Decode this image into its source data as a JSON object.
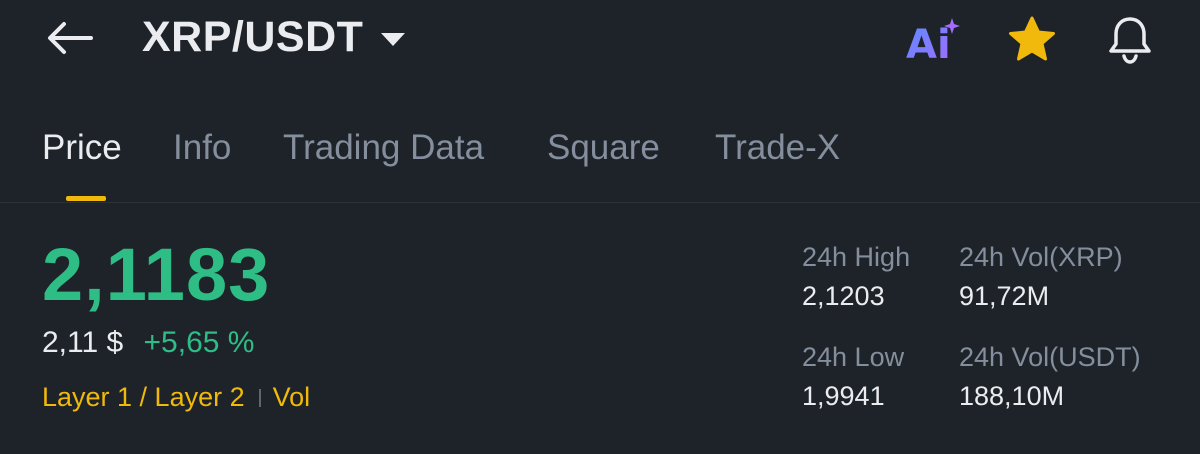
{
  "header": {
    "pair_title": "XRP/USDT",
    "ai_label": "Ai",
    "icons": [
      "back-arrow-icon",
      "chevron-down-icon",
      "ai-icon",
      "star-icon",
      "bell-icon"
    ],
    "star_color": "#f0b90b",
    "ai_gradient": [
      "#5b8cff",
      "#9b6bff"
    ]
  },
  "tabs": [
    {
      "label": "Price",
      "active": true
    },
    {
      "label": "Info",
      "active": false
    },
    {
      "label": "Trading Data",
      "active": false
    },
    {
      "label": "Square",
      "active": false
    },
    {
      "label": "Trade-X",
      "active": false
    }
  ],
  "ticker": {
    "last_price": "2,1183",
    "fiat_price": "2,11 $",
    "change_percent": "+5,65 %",
    "tag": "Layer 1 / Layer 2",
    "tag_extra": "Vol"
  },
  "stats": {
    "high_label": "24h High",
    "high_value": "2,1203",
    "low_label": "24h Low",
    "low_value": "1,9941",
    "vol_base_label": "24h Vol(XRP)",
    "vol_base_value": "91,72M",
    "vol_quote_label": "24h Vol(USDT)",
    "vol_quote_value": "188,10M"
  },
  "colors": {
    "background": "#1e2329",
    "positive": "#2ebd85",
    "accent": "#f0b90b",
    "muted": "#848e9c",
    "text": "#eaecef"
  }
}
